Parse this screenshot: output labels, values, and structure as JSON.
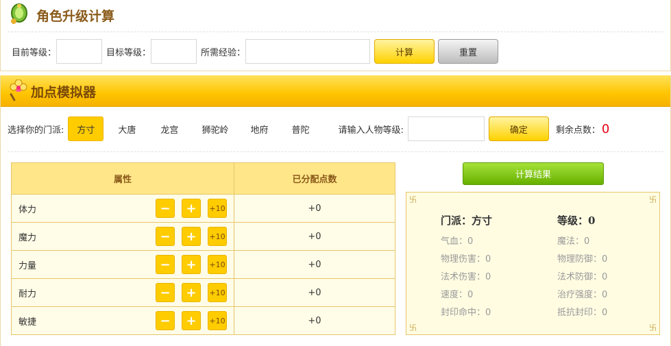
{
  "upgrade": {
    "title": "角色升级计算",
    "current_level_label": "目前等级：",
    "target_level_label": "目标等级：",
    "exp_label": "所需经验：",
    "calc_button": "计算",
    "reset_button": "重置"
  },
  "simulator": {
    "title": "加点模拟器",
    "sect_label": "选择你的门派:",
    "sects": [
      "方寸",
      "大唐",
      "龙宫",
      "狮驼岭",
      "地府",
      "普陀"
    ],
    "active_sect": "方寸",
    "level_label": "请输入人物等级:",
    "confirm_button": "确定",
    "remaining_label": "剩余点数：",
    "remaining_value": "0"
  },
  "table": {
    "headers": [
      "属性",
      "已分配点数"
    ],
    "rows": [
      {
        "name": "体力",
        "value": "+0"
      },
      {
        "name": "魔力",
        "value": "+0"
      },
      {
        "name": "力量",
        "value": "+0"
      },
      {
        "name": "耐力",
        "value": "+0"
      },
      {
        "name": "敏捷",
        "value": "+0"
      }
    ],
    "minus_label": "−",
    "plus_label": "+",
    "plus10_label": "+10"
  },
  "result": {
    "button": "计算结果",
    "sect": "门派：方寸",
    "level": "等级：0",
    "left": [
      "气血：0",
      "物理伤害：0",
      "法术伤害：0",
      "速度：0",
      "封印命中：0"
    ],
    "right": [
      "魔法：0",
      "物理防御：0",
      "法术防御：0",
      "治疗强度：0",
      "抵抗封印：0"
    ],
    "corner_glyph": "卐"
  },
  "colors": {
    "accent_yellow": "#ffcc00",
    "title_brown": "#8a5a1a",
    "result_green": "#66b000",
    "remaining_red": "#e60012"
  }
}
